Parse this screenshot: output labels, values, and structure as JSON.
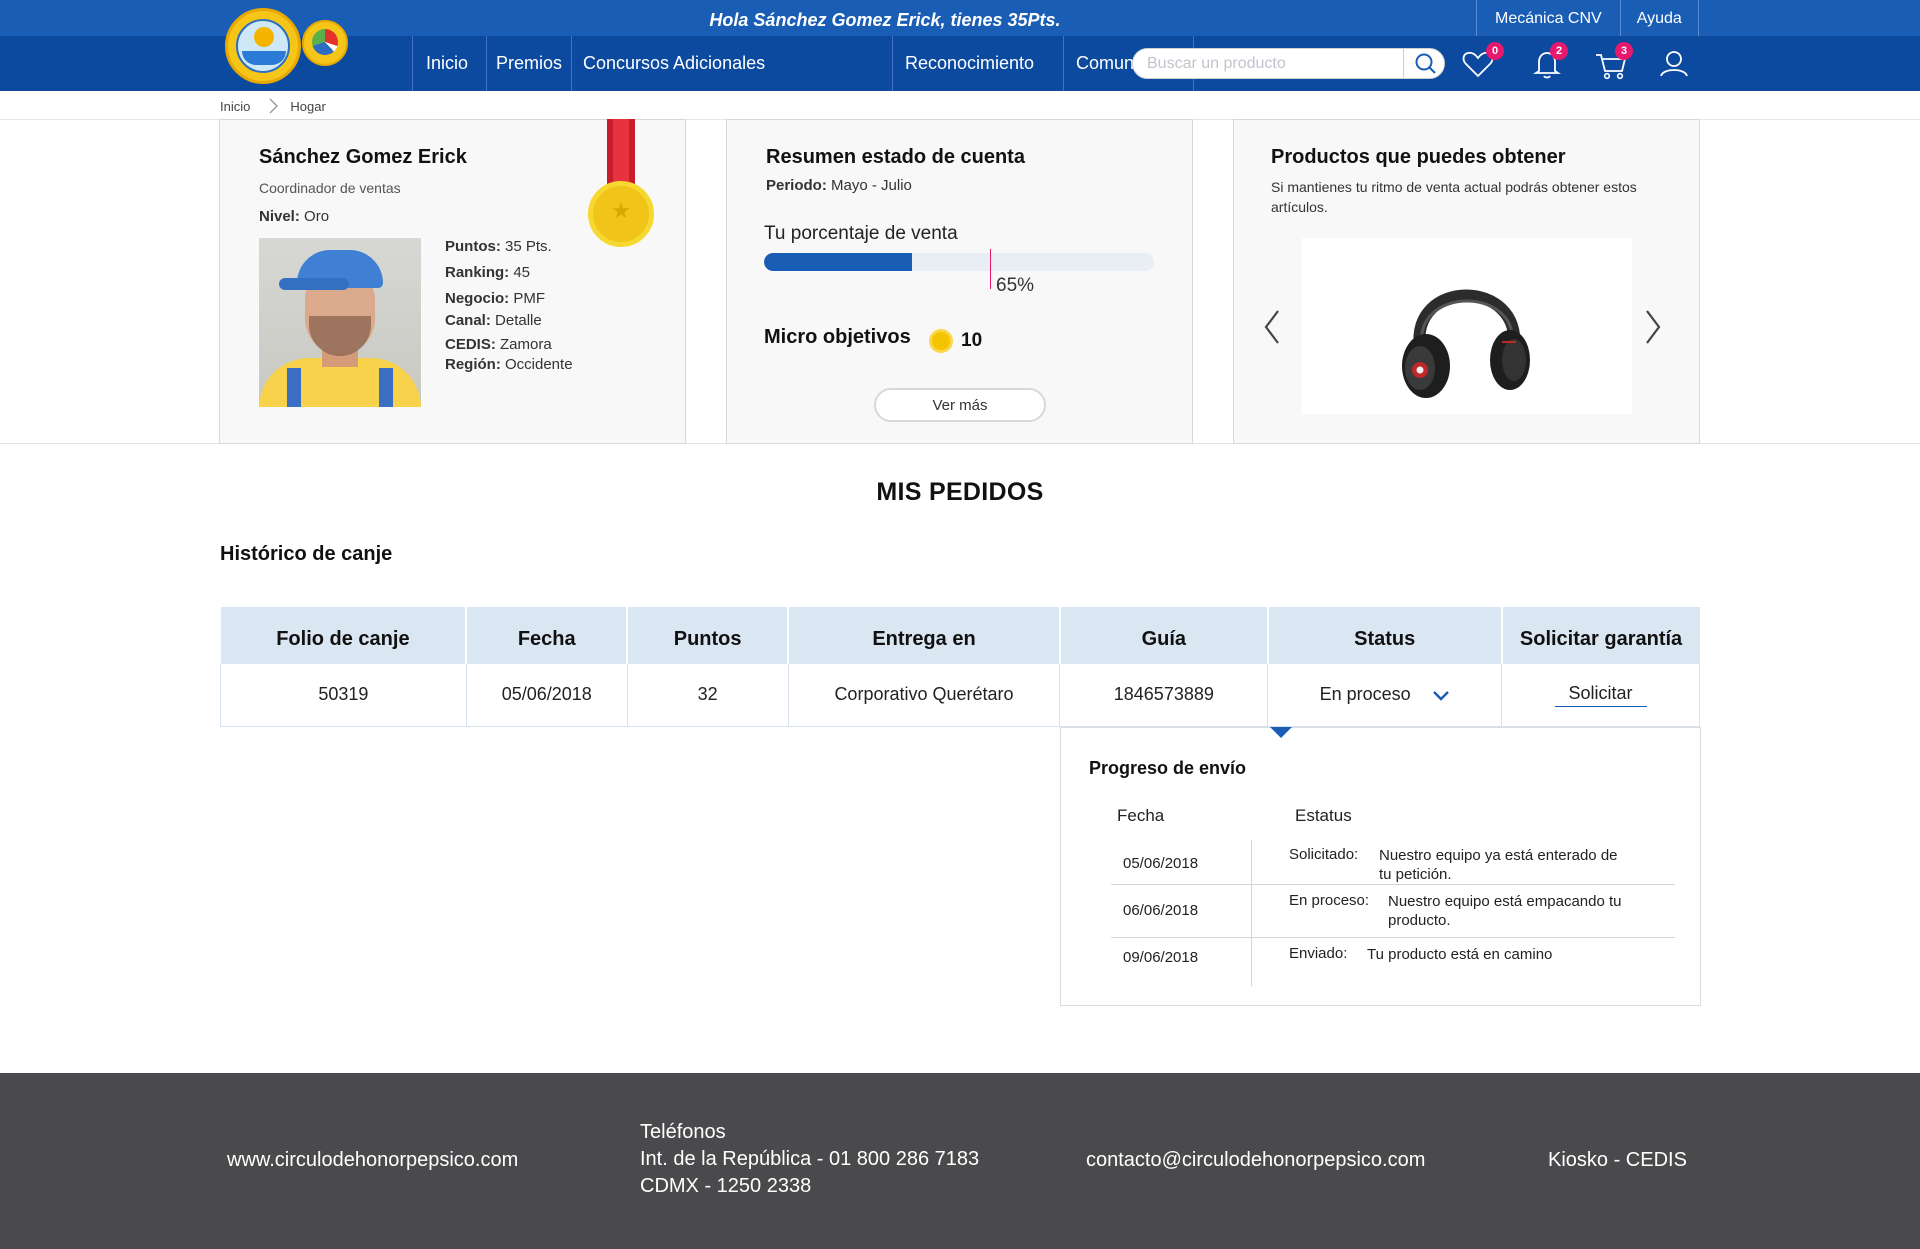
{
  "header": {
    "greeting": "Hola Sánchez Gomez Erick, tienes 35Pts.",
    "top_links": [
      "Mecánica CNV",
      "Ayuda"
    ],
    "logo_tag": "PEPSICO"
  },
  "nav": {
    "menu": [
      "Inicio",
      "Premios",
      "Concursos Adicionales",
      "Reconocimiento",
      "Comunidad"
    ],
    "search_placeholder": "Buscar un producto",
    "badges": {
      "favorites": "0",
      "notifications": "2",
      "cart": "3"
    },
    "icons": [
      "search-icon",
      "heart-icon",
      "bell-icon",
      "cart-icon",
      "user-icon"
    ],
    "colors": {
      "primary": "#0c4aa0",
      "topbar": "#1a5db4",
      "badge": "#e6196c"
    }
  },
  "breadcrumb": [
    "Inicio",
    "Hogar"
  ],
  "profile": {
    "name": "Sánchez Gomez Erick",
    "role": "Coordinador de ventas",
    "level_label": "Nivel:",
    "level": "Oro",
    "facts": [
      {
        "label": "Puntos:",
        "value": "35 Pts."
      },
      {
        "label": "Ranking:",
        "value": "45"
      },
      {
        "label": "Negocio:",
        "value": "PMF"
      },
      {
        "label": "Canal:",
        "value": "Detalle"
      },
      {
        "label": "CEDIS:",
        "value": "Zamora"
      },
      {
        "label": "Región:",
        "value": "Occidente"
      }
    ]
  },
  "account": {
    "title": "Resumen estado de cuenta",
    "period_label": "Periodo:",
    "period": "Mayo - Julio",
    "sales_label": "Tu porcentaje de venta",
    "sales_percent": 65,
    "sales_percent_text": "65%",
    "micro_label": "Micro objetivos",
    "micro_value": "10",
    "more_button": "Ver más"
  },
  "products": {
    "title": "Productos que puedes obtener",
    "subtitle": "Si mantienes tu ritmo de venta actual podrás obtener estos artículos."
  },
  "orders": {
    "title": "MIS PEDIDOS",
    "subtitle": "Histórico de canje",
    "columns": [
      "Folio de canje",
      "Fecha",
      "Puntos",
      "Entrega en",
      "Guía",
      "Status",
      "Solicitar garantía"
    ],
    "rows": [
      {
        "folio": "50319",
        "fecha": "05/06/2018",
        "puntos": "32",
        "entrega": "Corporativo Querétaro",
        "guia": "1846573889",
        "status": "En proceso",
        "action": "Solicitar"
      }
    ],
    "tracking": {
      "title": "Progreso de envío",
      "col_date": "Fecha",
      "col_status": "Estatus",
      "steps": [
        {
          "date": "05/06/2018",
          "status": "Solicitado:",
          "desc": "Nuestro equipo ya está enterado de tu petición."
        },
        {
          "date": "06/06/2018",
          "status": "En proceso:",
          "desc": "Nuestro equipo está empacando tu producto."
        },
        {
          "date": "09/06/2018",
          "status": "Enviado:",
          "desc": "Tu producto está en camino"
        }
      ]
    }
  },
  "footer": {
    "website": "www.circulodehonorpepsico.com",
    "phones_title": "Teléfonos",
    "phone_republic": "Int. de la República - 01 800 286 7183",
    "phone_cdmx": "CDMX - 1250 2338",
    "email": "contacto@circulodehonorpepsico.com",
    "kiosk": "Kiosko - CEDIS"
  }
}
